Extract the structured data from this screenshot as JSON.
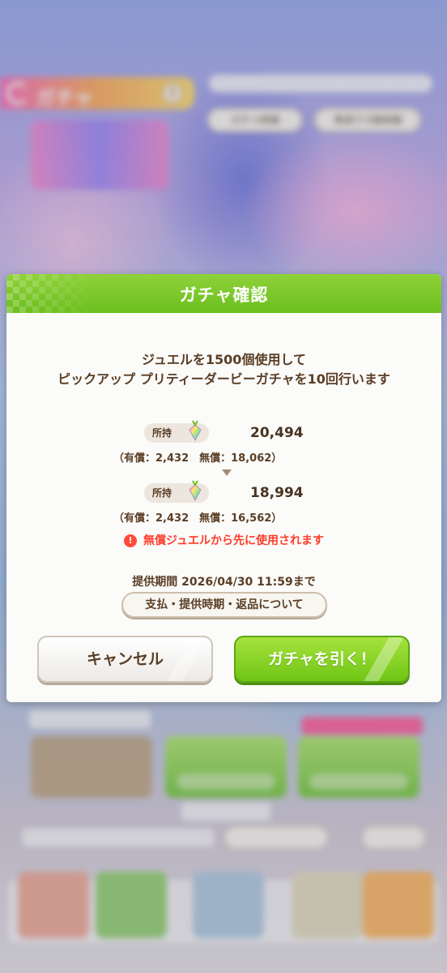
{
  "background": {
    "screen_title": "ガチャ",
    "info_icon": "i",
    "buttons": [
      "ガチャ詳細",
      "育成ウマ娘詳細"
    ]
  },
  "dialog": {
    "title": "ガチャ確認",
    "message_line1": "ジュエルを1500個使用して",
    "message_line2": "ピックアップ プリティーダービーガチャを10回行います",
    "before": {
      "owned_label": "所持",
      "total": "20,494",
      "breakdown": "（有償：2,432　無償：18,062）"
    },
    "after": {
      "owned_label": "所持",
      "total": "18,994",
      "breakdown": "（有償：2,432　無償：16,562）"
    },
    "warning_icon": "!",
    "warning": "無償ジュエルから先に使用されます",
    "period": "提供期間 2026/04/30 11:59まで",
    "info_button": "支払・提供時期・返品について",
    "cancel_button": "キャンセル",
    "pull_button": "ガチャを引く！"
  },
  "colors": {
    "header_green": "#6cbf1f",
    "text_brown": "#5a3e25",
    "warning_red": "#ff3c2a",
    "pull_button_green": "#7fd024"
  },
  "icons": {
    "back": "back-arrow-icon",
    "info": "info-icon",
    "jewel": "jewel-icon",
    "arrow": "arrow-down-icon",
    "warning": "warning-icon"
  }
}
